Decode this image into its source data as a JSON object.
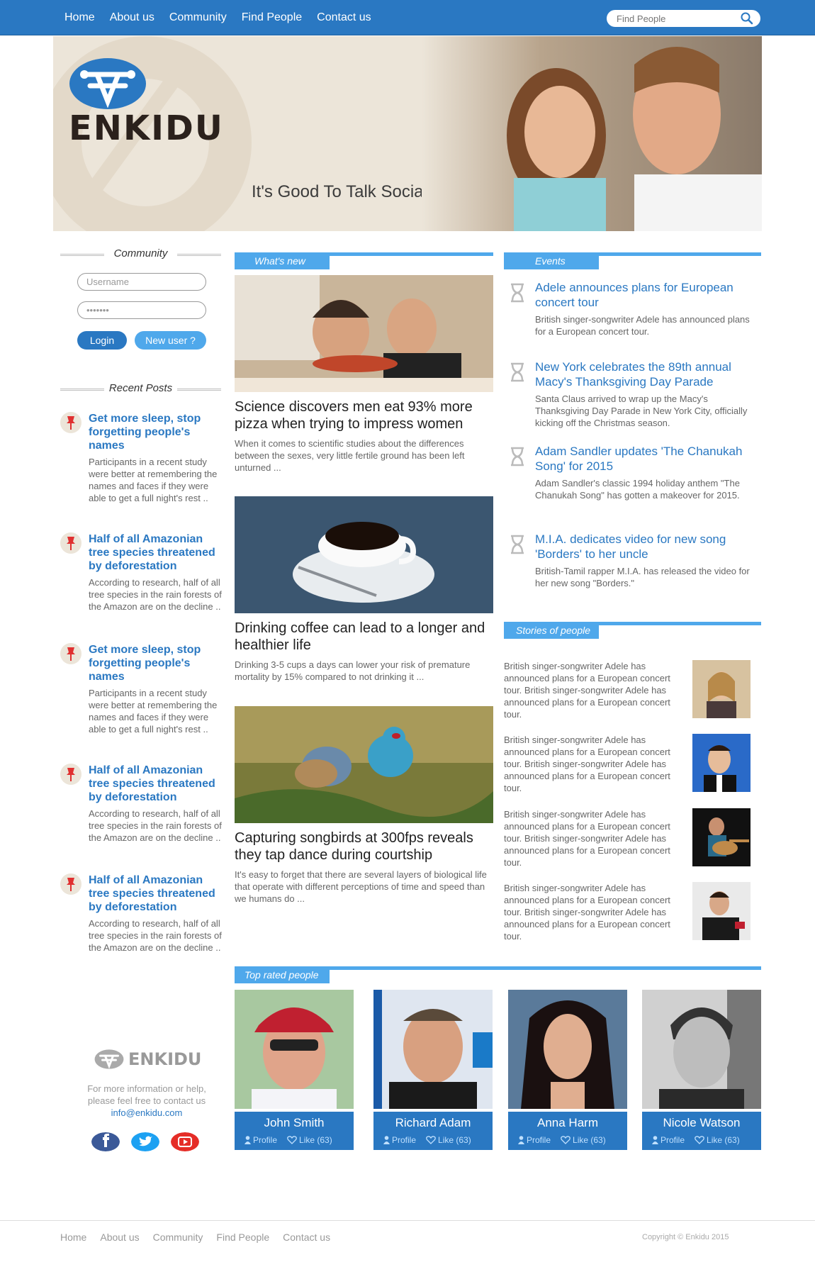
{
  "nav": {
    "items": [
      "Home",
      "About us",
      "Community",
      "Find People",
      "Contact us"
    ],
    "search_placeholder": "Find People"
  },
  "hero": {
    "brand": "ENKIDU",
    "tagline": "It's Good To Talk Social"
  },
  "community": {
    "title": "Community",
    "username_placeholder": "Username",
    "password_value": "•••••••",
    "login_label": "Login",
    "new_user_label": "New user ?"
  },
  "recent_posts": {
    "title": "Recent Posts",
    "items": [
      {
        "title": "Get more sleep, stop forgetting people's names",
        "body": "Participants in a recent study were better at remembering the names and faces if they were able to get a full night's rest .."
      },
      {
        "title": "Half of all Amazonian tree species threatened by deforestation",
        "body": "According to research, half of all tree species in the rain forests of the Amazon are on the decline .."
      },
      {
        "title": "Get more sleep, stop forgetting people's names",
        "body": "Participants in a recent study were better at remembering the names and faces if they were able to get a full night's rest .."
      },
      {
        "title": "Half of all Amazonian tree species threatened by deforestation",
        "body": "According to research, half of all tree species in the rain forests of the Amazon are on the decline .."
      },
      {
        "title": "Half of all Amazonian tree species threatened by deforestation",
        "body": "According to research, half of all tree species in the rain forests of the Amazon are on the decline .."
      }
    ]
  },
  "sidebar_footer": {
    "brand": "ENKIDU",
    "contact_text": "For more information or help, please feel free to contact us",
    "email": "info@enkidu.com",
    "social": [
      "facebook-icon",
      "twitter-icon",
      "youtube-icon"
    ]
  },
  "whats_new": {
    "title": "What's new",
    "articles": [
      {
        "title": "Science discovers men eat 93% more pizza when trying to impress women",
        "body": "When it comes to scientific studies about the differences between the sexes, very little fertile ground has been left unturned ..."
      },
      {
        "title": "Drinking coffee can lead to a longer and healthier life",
        "body": "Drinking 3-5 cups a days can lower your risk of premature mortality by 15% compared to not drinking it ..."
      },
      {
        "title": "Capturing songbirds at 300fps reveals they tap dance during courtship",
        "body": "It's easy to forget that there are several layers of biological life that operate with different perceptions of time and speed than we humans do ..."
      }
    ]
  },
  "events": {
    "title": "Events",
    "items": [
      {
        "title": "Adele announces plans for European concert tour",
        "body": "British singer-songwriter Adele has announced plans for a European concert tour."
      },
      {
        "title": "New York celebrates the 89th annual Macy's Thanksgiving Day Parade",
        "body": "Santa Claus arrived to wrap up the Macy's Thanksgiving Day Parade in New York City, officially kicking off the Christmas season."
      },
      {
        "title": "Adam Sandler updates 'The Chanukah Song' for 2015",
        "body": "Adam Sandler's classic 1994 holiday anthem \"The Chanukah Song\" has gotten a makeover for 2015."
      },
      {
        "title": "M.I.A. dedicates video for new song 'Borders' to her uncle",
        "body": "British-Tamil rapper M.I.A. has released the video for her new song \"Borders.\""
      }
    ]
  },
  "stories": {
    "title": "Stories of people",
    "items": [
      {
        "text": "British singer-songwriter Adele has announced plans for a European concert tour. British singer-songwriter Adele has announced plans for a European concert tour."
      },
      {
        "text": "British singer-songwriter Adele has announced plans for a European concert tour. British singer-songwriter Adele has announced plans for a European concert tour."
      },
      {
        "text": "British singer-songwriter Adele has announced plans for a European concert tour. British singer-songwriter Adele has announced plans for a European concert tour."
      },
      {
        "text": "British singer-songwriter Adele has announced plans for a European concert tour. British singer-songwriter Adele has announced plans for a European concert tour."
      }
    ]
  },
  "top_rated": {
    "title": "Top rated people",
    "people": [
      {
        "name": "John Smith",
        "profile": "Profile",
        "like": "Like (63)"
      },
      {
        "name": "Richard Adam",
        "profile": "Profile",
        "like": "Like (63)"
      },
      {
        "name": "Anna Harm",
        "profile": "Profile",
        "like": "Like (63)"
      },
      {
        "name": "Nicole Watson",
        "profile": "Profile",
        "like": "Like (63)"
      }
    ]
  },
  "footer": {
    "items": [
      "Home",
      "About us",
      "Community",
      "Find People",
      "Contact us"
    ],
    "copyright": "Copyright © Enkidu 2015"
  },
  "colors": {
    "primary": "#2a78c2",
    "accent": "#4fa8eb",
    "hero_bg": "#ece5d9"
  }
}
